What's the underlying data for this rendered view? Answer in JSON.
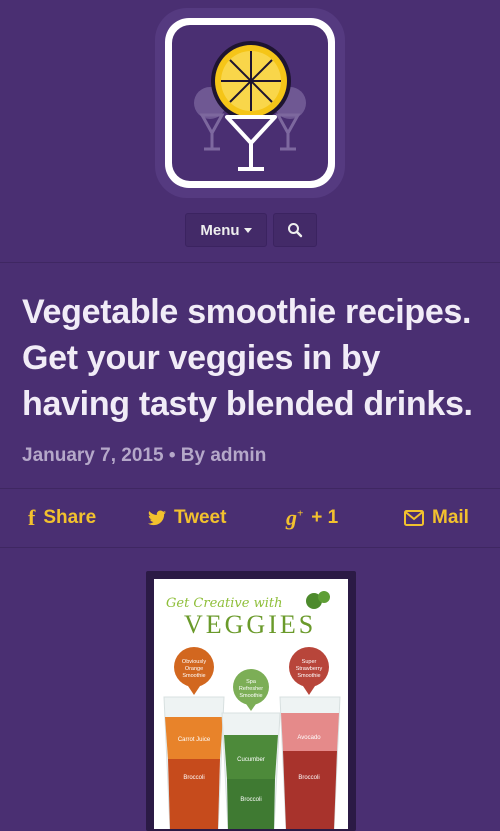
{
  "nav": {
    "menu_label": "Menu",
    "search_icon": "search-icon"
  },
  "article": {
    "title": "Vegetable smoothie recipes. Get your veggies in by having tasty blended drinks.",
    "date": "January 7, 2015",
    "separator": "•",
    "by": "By",
    "author": "admin"
  },
  "share": {
    "facebook": "Share",
    "twitter": "Tweet",
    "gplus": "+ 1",
    "mail": "Mail"
  },
  "poster": {
    "headline_script": "Get Creative with",
    "headline": "VEGGIES",
    "cups": [
      {
        "tag": "Obviously Orange Smoothie",
        "l1": "Carrot Juice",
        "l2": "Broccoli"
      },
      {
        "tag": "Spa Refresher Smoothie",
        "l1": "Cucumber",
        "l2": "Broccoli"
      },
      {
        "tag": "Super Strawberry Smoothie",
        "l1": "Avocado",
        "l2": "Broccoli"
      }
    ]
  },
  "colors": {
    "background": "#4a2f72",
    "accent": "#f2c12e",
    "title_text": "#f1ecf7",
    "meta_text": "#b5a8c9"
  }
}
